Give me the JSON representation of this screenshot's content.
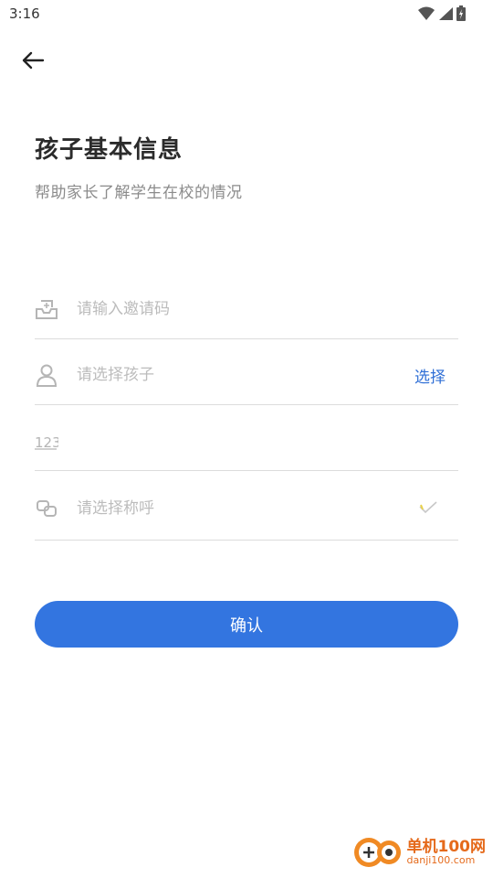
{
  "status_bar": {
    "time": "3:16"
  },
  "header": {
    "title": "孩子基本信息",
    "subtitle": "帮助家长了解学生在校的情况"
  },
  "form": {
    "invite_placeholder": "请输入邀请码",
    "child_placeholder": "请选择孩子",
    "child_select_label": "选择",
    "number_value": "",
    "call_placeholder": "请选择称呼"
  },
  "confirm_label": "确认",
  "watermark": {
    "main": "单机100网",
    "url": "danji100.com"
  },
  "colors": {
    "primary": "#3375e0",
    "link": "#2f6fd6",
    "watermark": "#e56a1b"
  }
}
